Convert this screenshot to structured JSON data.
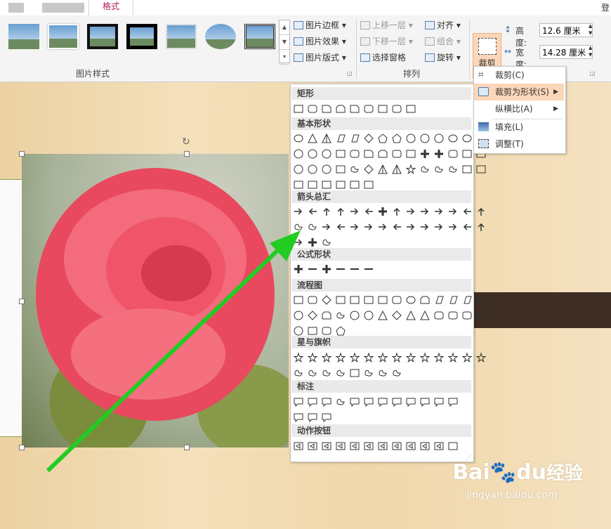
{
  "tabs": {
    "active": "格式",
    "right_text": "登"
  },
  "ribbon": {
    "picture_styles_label": "图片样式",
    "picture_border": "图片边框",
    "picture_effects": "图片效果",
    "picture_layout": "图片版式",
    "bring_forward": "上移一层",
    "send_backward": "下移一层",
    "selection_pane": "选择窗格",
    "align": "对齐",
    "group": "组合",
    "rotate": "旋转",
    "arrange_label": "排列",
    "crop": "裁剪",
    "height_label": "高度:",
    "height_value": "12.6 厘米",
    "width_label": "宽度:",
    "width_value": "14.28 厘米"
  },
  "crop_menu": {
    "items": [
      {
        "label": "裁剪(C)",
        "icon": "crop-icon"
      },
      {
        "label": "裁剪为形状(S)",
        "icon": "crop-to-shape-icon",
        "submenu": true,
        "highlighted": true
      },
      {
        "label": "纵横比(A)",
        "icon": "",
        "submenu": true
      },
      {
        "label": "填充(L)",
        "icon": "fill-icon"
      },
      {
        "label": "调整(T)",
        "icon": "fit-icon"
      }
    ]
  },
  "shapes_menu": {
    "categories": [
      "矩形",
      "基本形状",
      "箭头总汇",
      "公式形状",
      "流程图",
      "星与旗帜",
      "标注",
      "动作按钮"
    ]
  },
  "watermark": {
    "brand": "Bai",
    "brand2": "du",
    "cn": "经验",
    "url": "jingyan.baidu.com"
  },
  "colors": {
    "accent_tab": "#b01a5d",
    "highlight": "#fbd6b8",
    "arrow": "#22cc22"
  }
}
